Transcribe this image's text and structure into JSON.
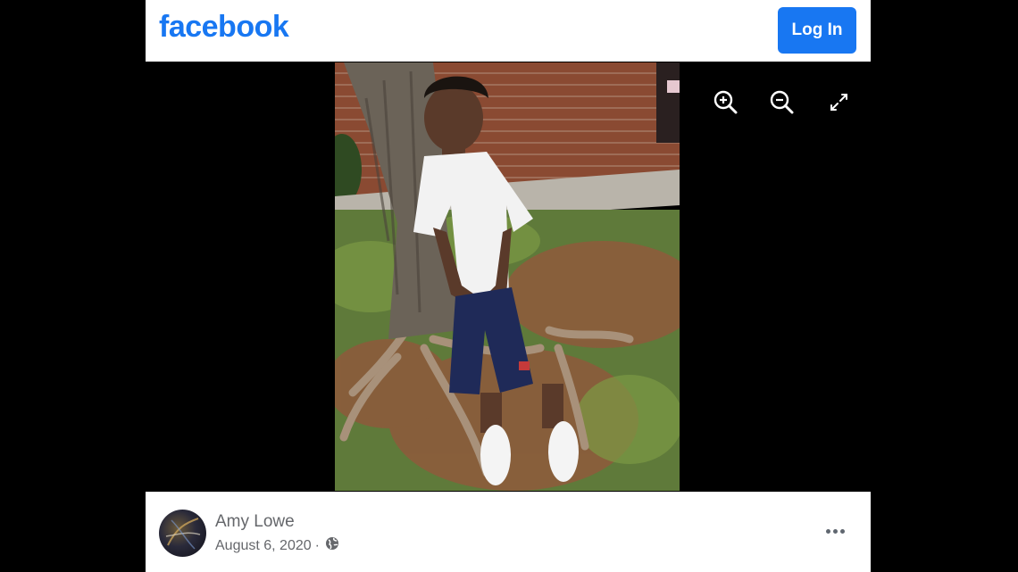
{
  "header": {
    "logo_text": "facebook",
    "login_label": "Log In",
    "brand_color": "#1877f2"
  },
  "viewer": {
    "controls": [
      {
        "name": "zoom-in-icon"
      },
      {
        "name": "zoom-out-icon"
      },
      {
        "name": "fullscreen-icon"
      }
    ]
  },
  "post": {
    "author": "Amy Lowe",
    "date": "August 6, 2020",
    "separator": "·",
    "privacy_icon": "globe-icon",
    "more_icon": "more-options-icon"
  }
}
